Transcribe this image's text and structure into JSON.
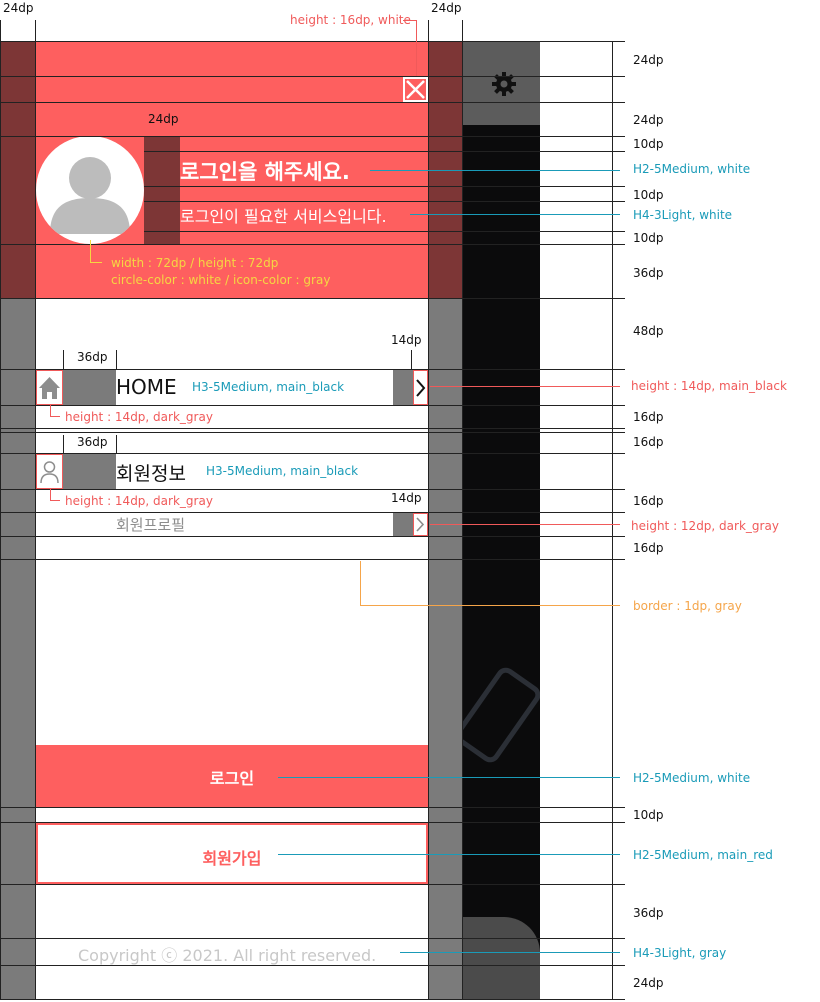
{
  "top_margin_labels": {
    "left": "24dp",
    "right": "24dp"
  },
  "header": {
    "title": "로그인을 해주세요.",
    "subtitle": "로그인이 필요한 서비스입니다.",
    "bg_color": "#fe5f5f",
    "close_icon": "close-icon",
    "avatar_icon": "user-avatar-icon"
  },
  "settings_icon": "gear-icon",
  "menu": {
    "home": {
      "label": "HOME",
      "icon": "home-icon",
      "arrow": "chevron-right-icon"
    },
    "member": {
      "label": "회원정보",
      "icon": "user-icon"
    },
    "profile": {
      "label": "회원프로필",
      "arrow": "chevron-right-icon"
    }
  },
  "buttons": {
    "login": "로그인",
    "signup": "회원가입"
  },
  "copyright": "Copyright ⓒ 2021. All right reserved.",
  "annotations": {
    "close_height": "height : 16dp, white",
    "gap_24": "24dp",
    "h2_white": "H2-5Medium, white",
    "h4_white": "H4-3Light, white",
    "avatar_size": "width : 72dp / height : 72dp",
    "avatar_colors": "circle-color : white / icon-color : gray",
    "home_spacing": "36dp",
    "arrow_width": "14dp",
    "h3_black_home": "H3-5Medium, main_black",
    "arrow_home": "height : 14dp, main_black",
    "icon_home": "height : 14dp, dark_gray",
    "member_spacing": "36dp",
    "h3_black_member": "H3-5Medium, main_black",
    "icon_member": "height : 14dp, dark_gray",
    "arrow_width_profile": "14dp",
    "arrow_profile": "height : 12dp, dark_gray",
    "border": "border : 1dp, gray",
    "login_font": "H2-5Medium, white",
    "signup_font": "H2-5Medium, main_red",
    "copyright_font": "H4-3Light, gray"
  },
  "right_dims": [
    "24dp",
    "24dp",
    "10dp",
    "10dp",
    "10dp",
    "36dp",
    "48dp",
    "16dp",
    "16dp",
    "16dp",
    "16dp",
    "10dp",
    "36dp",
    "24dp"
  ],
  "colors": {
    "main_red": "#fe5f5f",
    "dark_panel": "#0b0b0c",
    "gray": "#7b7b7b"
  }
}
